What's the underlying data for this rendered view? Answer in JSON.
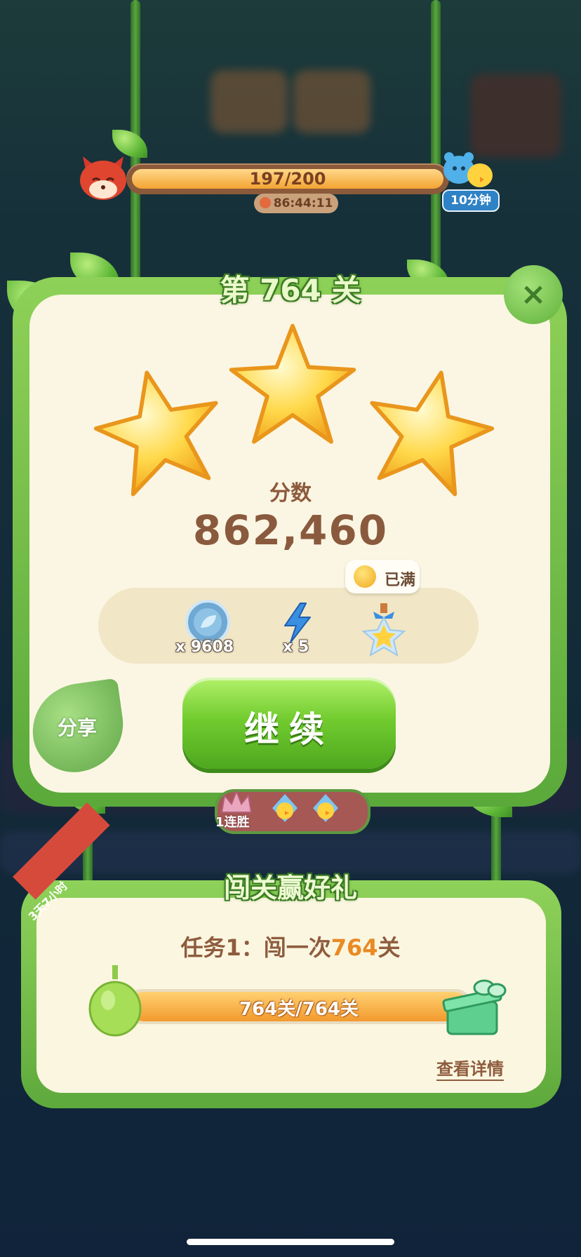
{
  "top_progress": {
    "text": "197/200",
    "fraction": 0.985,
    "timer": "86:44:11",
    "reward_badge": "10分钟"
  },
  "level_panel": {
    "title": "第 764 关",
    "stars_earned": 3,
    "score_label": "分数",
    "score_value": "862,460",
    "items": [
      {
        "icon": "leaf-coin-icon",
        "count": "x 9608"
      },
      {
        "icon": "lightning-icon",
        "count": "x 5"
      },
      {
        "icon": "star-jar-icon",
        "count": ""
      }
    ],
    "full_tip": "已满",
    "share_label": "分享",
    "continue_label": "继续",
    "streak_label": "1连胜"
  },
  "challenge": {
    "title": "闯关赢好礼",
    "ribbon": "3天7小时",
    "task_prefix": "任务",
    "task_num": "1",
    "task_mid": "：闯一次",
    "task_level": "764",
    "task_suffix": "关",
    "progress_text": "764关/764关",
    "progress_fraction": 1.0,
    "details_link": "查看详情"
  },
  "colors": {
    "panel_green": "#5fb13b",
    "panel_cream": "#fbf6e3",
    "score_brown": "#8a5a3e",
    "continue_green": "#72cc2f",
    "progress_orange": "#f39a2e"
  }
}
